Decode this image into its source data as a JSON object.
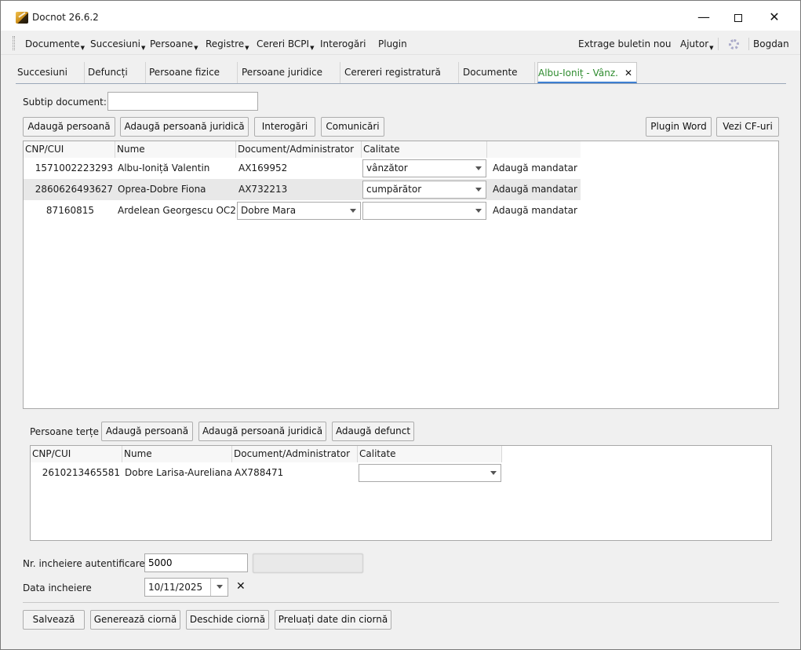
{
  "window": {
    "title": "Docnot 26.6.2"
  },
  "menubar": {
    "items": [
      "Documente",
      "Succesiuni",
      "Persoane",
      "Registre",
      "Cereri BCPI",
      "Interogări",
      "Plugin"
    ],
    "right_items": [
      "Extrage buletin nou",
      "Ajutor"
    ],
    "user": "Bogdan"
  },
  "tabs": {
    "items": [
      "Succesiuni",
      "Defuncți",
      "Persoane fizice",
      "Persoane juridice",
      "Cerereri registratură",
      "Documente",
      "Albu-Ioniț - Vânz."
    ]
  },
  "form": {
    "subtip_label": "Subtip document:",
    "subtip_value": "",
    "buttons": {
      "add_person": "Adaugă persoană",
      "add_legal_person": "Adaugă persoană juridică",
      "queries": "Interogări",
      "communications": "Comunicări",
      "plugin_word": "Plugin Word",
      "view_cf": "Vezi CF-uri"
    }
  },
  "parties_table": {
    "columns": [
      "CNP/CUI",
      "Nume",
      "Document/Administrator",
      "Calitate"
    ],
    "rows": [
      {
        "cnp": "1571002223293",
        "name": "Albu-Ioniță Valentin",
        "document": "AX169952",
        "calitate": "vânzător",
        "action": "Adaugă mandatar"
      },
      {
        "cnp": "2860626493627",
        "name": "Oprea-Dobre Fiona",
        "document": "AX732213",
        "calitate": "cumpărător",
        "action": "Adaugă mandatar"
      },
      {
        "cnp": "87160815",
        "name": "Ardelean Georgescu OC2",
        "document": "Dobre Mara",
        "calitate": "",
        "action": "Adaugă mandatar"
      }
    ]
  },
  "third_parties": {
    "label": "Persoane terțe",
    "buttons": {
      "add_person": "Adaugă persoană",
      "add_legal_person": "Adaugă persoană juridică",
      "add_deceased": "Adaugă defunct"
    },
    "columns": [
      "CNP/CUI",
      "Nume",
      "Document/Administrator",
      "Calitate"
    ],
    "rows": [
      {
        "cnp": "2610213465581",
        "name": "Dobre Larisa-Aureliana",
        "document": "AX788471",
        "calitate": ""
      }
    ]
  },
  "closing": {
    "nr_label": "Nr. incheiere autentificare",
    "nr_value": "5000",
    "date_label": "Data incheiere",
    "date_value": "10/11/2025",
    "buttons": {
      "save": "Salvează",
      "generate_draft": "Generează ciornă",
      "open_draft": "Deschide ciornă",
      "import_draft": "Preluați date din ciornă"
    }
  },
  "icons": {
    "app": "docnot-app-icon",
    "settings": "gear-icon",
    "clear_date": "close-icon"
  }
}
